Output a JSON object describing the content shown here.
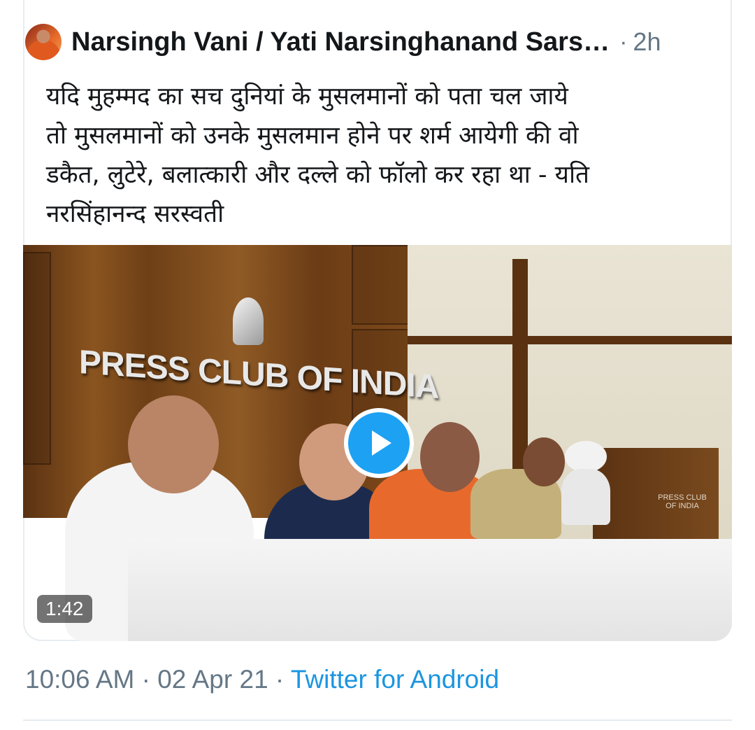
{
  "tweet": {
    "author_name": "Narsingh Vani / Yati Narsinghanand Sars…",
    "separator": "·",
    "relative_time": "2h",
    "text_lines": [
      "यदि मुहम्मद का सच दुनियां के मुसलमानों को पता चल जाये",
      "तो मुसलमानों को उनके मुसलमान होने पर शर्म आयेगी की वो",
      "डकैत, लुटेरे, बलात्कारी और दल्ले को फॉलो कर रहा था - यति",
      "नरसिंहानन्द सरस्वती"
    ]
  },
  "media": {
    "sign_text": "PRESS CLUB OF INDIA",
    "podium_sign": "PRESS CLUB OF INDIA",
    "duration": "1:42",
    "play_icon": "play-icon"
  },
  "footer": {
    "time": "10:06 AM",
    "sep1": "·",
    "date": "02 Apr 21",
    "sep2": "·",
    "client": "Twitter for Android"
  },
  "colors": {
    "accent": "#1da1f2",
    "muted": "#657786",
    "link": "#1b95e0"
  }
}
